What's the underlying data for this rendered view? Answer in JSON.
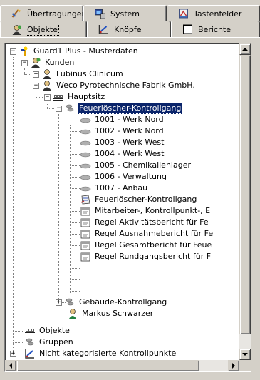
{
  "tabs_top": [
    {
      "label": "Übertragungen",
      "icon": "transfer-icon"
    },
    {
      "label": "System",
      "icon": "system-icon"
    },
    {
      "label": "Tastenfelder",
      "icon": "keypad-icon"
    }
  ],
  "tabs_bottom": [
    {
      "label": "Objekte",
      "icon": "objects-icon",
      "active": true
    },
    {
      "label": "Knöpfe",
      "icon": "buttons-icon"
    },
    {
      "label": "Berichte",
      "icon": "reports-icon"
    }
  ],
  "tree": {
    "root": "Guard1 Plus - Musterdaten",
    "kunden": "Kunden",
    "lubinus": "Lubinus Clinicum",
    "weco": "Weco Pyrotechnische Fabrik GmbH.",
    "hauptsitz": "Hauptsitz",
    "feuer_group": "Feuerlöscher-Kontrollgang",
    "checkpoints": [
      "1001 - Werk Nord",
      "1002 - Werk Nord",
      "1003 - Werk West",
      "1004 - Werk West",
      "1005 - Chemikalienlager",
      "1006 - Verwaltung",
      "1007 - Anbau"
    ],
    "tour": "Feuerlöscher-Kontrollgang",
    "rules": [
      "Mitarbeiter-, Kontrollpunkt-, E",
      "Regel Aktivitätsbericht für Fe",
      "Regel Ausnahmebericht für Fe",
      "Regel Gesamtbericht für Feue",
      "Regel Rundgangsbericht für F"
    ],
    "gebaeude": "Gebäude-Kontrollgang",
    "markus": "Markus Schwarzer",
    "objekte": "Objekte",
    "gruppen": "Gruppen",
    "nicht": "Nicht kategorisierte Kontrollpunkte"
  },
  "colors": {
    "selection": "#0a246a",
    "face": "#d4d0c8"
  }
}
